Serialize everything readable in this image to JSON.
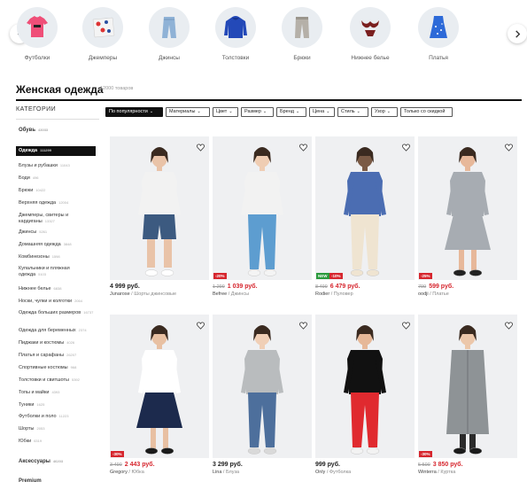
{
  "categories": [
    {
      "label": "Футболки",
      "icon": "tshirt-icon"
    },
    {
      "label": "Джемперы",
      "icon": "sweater-icon"
    },
    {
      "label": "Джинсы",
      "icon": "jeans-icon"
    },
    {
      "label": "Толстовки",
      "icon": "hoodie-icon"
    },
    {
      "label": "Брюки",
      "icon": "pants-icon"
    },
    {
      "label": "Нижнее белье",
      "icon": "lingerie-icon"
    },
    {
      "label": "Платья",
      "icon": "dress-icon"
    }
  ],
  "title": "Женская одежда",
  "count": "12000 товаров",
  "sidebar": {
    "heading": "КАТЕГОРИИ",
    "items": [
      {
        "label": "Обувь",
        "count": "43033",
        "style": "bold"
      },
      {
        "label": "Одежда",
        "count": "111299",
        "style": "active"
      },
      {
        "label": "Блузы и рубашки",
        "count": "11043",
        "style": ""
      },
      {
        "label": "Боди",
        "count": "496",
        "style": ""
      },
      {
        "label": "Брюки",
        "count": "10422",
        "style": ""
      },
      {
        "label": "Верхняя одежда",
        "count": "12004",
        "style": ""
      },
      {
        "label": "Джемперы, свитеры и кардиганы",
        "count": "13327",
        "style": ""
      },
      {
        "label": "Джинсы",
        "count": "5261",
        "style": ""
      },
      {
        "label": "Домашняя одежда",
        "count": "3848",
        "style": ""
      },
      {
        "label": "Комбинезоны",
        "count": "1598",
        "style": ""
      },
      {
        "label": "Купальники и пляжная одежда",
        "count": "5103",
        "style": ""
      },
      {
        "label": "Нижнее белье",
        "count": "6838",
        "style": ""
      },
      {
        "label": "Носки, чулки и колготки",
        "count": "2064",
        "style": ""
      },
      {
        "label": "Одежда больших размеров",
        "count": "16737",
        "style": ""
      },
      {
        "label": "Одежда для беременных",
        "count": "2374",
        "style": ""
      },
      {
        "label": "Пиджаки и костюмы",
        "count": "4026",
        "style": ""
      },
      {
        "label": "Платья и сарафаны",
        "count": "26207",
        "style": ""
      },
      {
        "label": "Спортивные костюмы",
        "count": "968",
        "style": ""
      },
      {
        "label": "Толстовки и свитшоты",
        "count": "5392",
        "style": ""
      },
      {
        "label": "Топы и майки",
        "count": "4393",
        "style": ""
      },
      {
        "label": "Туники",
        "count": "1625",
        "style": ""
      },
      {
        "label": "Футболки и поло",
        "count": "11223",
        "style": ""
      },
      {
        "label": "Шорты",
        "count": "2053",
        "style": ""
      },
      {
        "label": "Юбки",
        "count": "6319",
        "style": ""
      },
      {
        "label": "Аксессуары",
        "count": "46203",
        "style": "bold"
      },
      {
        "label": "Premium",
        "count": "",
        "style": "bold"
      }
    ]
  },
  "filters": [
    {
      "label": "По популярности",
      "dark": true
    },
    {
      "label": "Материалы",
      "dark": false
    },
    {
      "label": "Цвет",
      "dark": false
    },
    {
      "label": "Размер",
      "dark": false
    },
    {
      "label": "Бренд",
      "dark": false
    },
    {
      "label": "Цена",
      "dark": false
    },
    {
      "label": "Стиль",
      "dark": false
    },
    {
      "label": "Узор",
      "dark": false
    },
    {
      "label": "Только со скидкой",
      "dark": false
    }
  ],
  "products": [
    {
      "price": "4 999 руб.",
      "old_price": "",
      "brand": "Junarose",
      "category": "Шорты джинсовые",
      "badge": "",
      "badge2": "",
      "colors": {
        "top": "#f2f2f2",
        "bottom": "#3c5a80",
        "skin": "#e9c3a8",
        "shoes": "#ffffff"
      }
    },
    {
      "price": "1 039 руб.",
      "old_price": "1 299",
      "brand": "Befree",
      "category": "Джинсы",
      "badge": "-20%",
      "badge2": "",
      "colors": {
        "top": "#f2f2f2",
        "bottom": "#5d9dd0",
        "skin": "#efcdb3",
        "shoes": "#f4f4f4"
      }
    },
    {
      "price": "6 479 руб.",
      "old_price": "8 499",
      "brand": "Rodier",
      "category": "Пуловер",
      "badge": "NEW",
      "badge2": "-10%",
      "colors": {
        "top": "#4b6db2",
        "bottom": "#efe4d1",
        "skin": "#7a5a45",
        "shoes": "#efe4d1"
      }
    },
    {
      "price": "599 руб.",
      "old_price": "799",
      "brand": "oodji",
      "category": "Платье",
      "badge": "-25%",
      "badge2": "",
      "colors": {
        "top": "#a7acb2",
        "bottom": "#a7acb2",
        "skin": "#e7b89a",
        "shoes": "#222222"
      }
    },
    {
      "price": "2 443 руб.",
      "old_price": "3 490",
      "brand": "Gregory",
      "category": "Юбка",
      "badge": "-30%",
      "badge2": "",
      "colors": {
        "top": "#ffffff",
        "bottom": "#1c2a4d",
        "skin": "#e8c0a2",
        "shoes": "#1a1a1a"
      }
    },
    {
      "price": "3 299 руб.",
      "old_price": "",
      "brand": "Lina",
      "category": "Блуза",
      "badge": "",
      "badge2": "",
      "colors": {
        "top": "#b9bcbe",
        "bottom": "#4d6f9c",
        "skin": "#f0cfb6",
        "shoes": "#d9d9d9"
      }
    },
    {
      "price": "999 руб.",
      "old_price": "",
      "brand": "Only",
      "category": "Футболка",
      "badge": "",
      "badge2": "",
      "colors": {
        "top": "#111111",
        "bottom": "#e02a2f",
        "skin": "#e6b898",
        "shoes": "#f2f2f2"
      }
    },
    {
      "price": "3 850 руб.",
      "old_price": "5 500",
      "brand": "Winterra",
      "category": "Куртка",
      "badge": "-30%",
      "badge2": "",
      "colors": {
        "top": "#8e9396",
        "bottom": "#8e9396",
        "skin": "#ecc7aa",
        "shoes": "#1b1b1b"
      }
    }
  ]
}
